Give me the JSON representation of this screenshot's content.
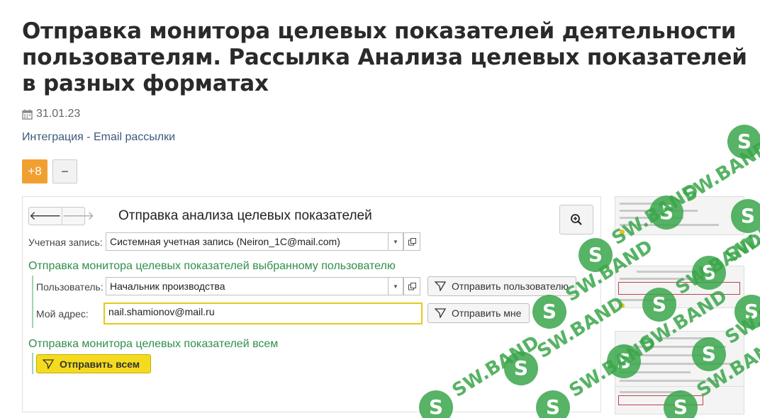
{
  "article": {
    "title": "Отправка монитора целевых показателей деятельности пользователям. Рассылка Анализа целевых показателей в разных форматах",
    "date": "31.01.23",
    "category": "Интеграция - Email рассылки",
    "rating_plus": "+8",
    "rating_minus": "−"
  },
  "form": {
    "title": "Отправка анализа целевых показателей",
    "account_label": "Учетная запись:",
    "account_value": "Системная учетная запись (Neiron_1C@mail.com)",
    "section_user": "Отправка монитора целевых показателей выбранному пользователю",
    "user_label": "Пользователь:",
    "user_value": "Начальник производства",
    "send_user_button": "Отправить пользователю",
    "my_address_label": "Мой адрес:",
    "my_address_value": "nail.shamionov@mail.ru",
    "send_me_button": "Отправить мне",
    "section_all": "Отправка монитора целевых показателей всем",
    "send_all_button": "Отправить всем"
  },
  "watermark": {
    "text": "SW.BAND",
    "color": "#3aa64a"
  },
  "icons": [
    "calendar-icon",
    "back-arrow-icon",
    "forward-arrow-icon",
    "zoom-icon",
    "dropdown-icon",
    "open-icon",
    "send-icon"
  ]
}
